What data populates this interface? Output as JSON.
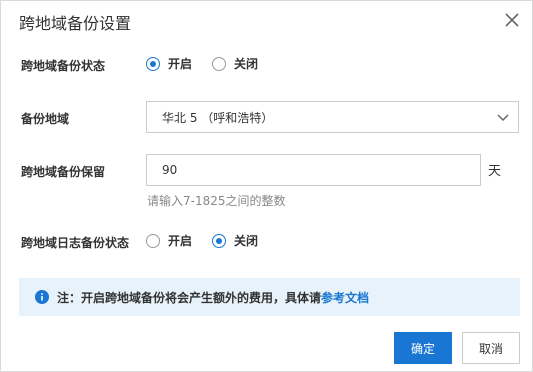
{
  "dialog": {
    "title": "跨地域备份设置",
    "close_icon": "close-icon"
  },
  "backup_status": {
    "label": "跨地域备份状态",
    "options": [
      {
        "label": "开启",
        "checked": true
      },
      {
        "label": "关闭",
        "checked": false
      }
    ]
  },
  "backup_region": {
    "label": "备份地域",
    "selected": "华北 5 （呼和浩特）",
    "chevron_icon": "chevron-down-icon"
  },
  "backup_retention": {
    "label": "跨地域备份保留",
    "value": "90",
    "unit": "天",
    "hint": "请输入7-1825之间的整数"
  },
  "log_backup_status": {
    "label": "跨地域日志备份状态",
    "options": [
      {
        "label": "开启",
        "checked": false
      },
      {
        "label": "关闭",
        "checked": true
      }
    ]
  },
  "notice": {
    "icon": "info-icon",
    "text": "注：开启跨地域备份将会产生额外的费用，具体请",
    "link_text": "参考文档"
  },
  "footer": {
    "confirm_label": "确定",
    "cancel_label": "取消"
  },
  "colors": {
    "primary": "#1976d2",
    "notice_bg": "#e7f2fa"
  }
}
